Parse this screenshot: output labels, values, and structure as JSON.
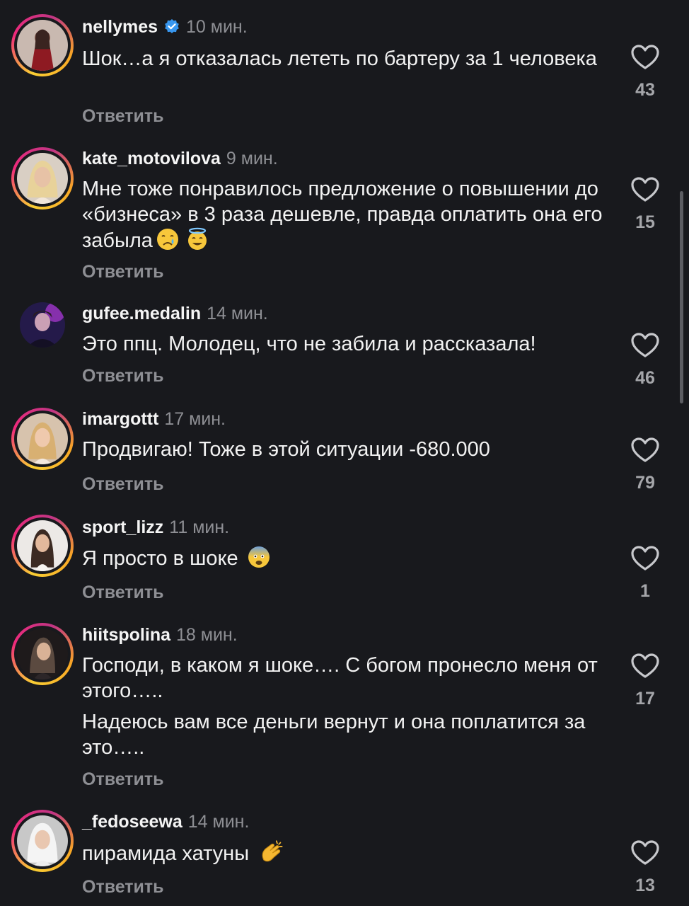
{
  "reply_label": "Ответить",
  "comments": [
    {
      "username": "nellymes",
      "verified": true,
      "time": "10 мин.",
      "text": [
        "Шок…а я отказалась лететь по бартеру за 1 человека"
      ],
      "likes": "43"
    },
    {
      "username": "kate_motovilova",
      "verified": false,
      "time": "9 мин.",
      "text": [
        "Мне тоже понравилось предложение о повышении до «бизнеса» в 3 раза дешевле, правда оплатить она его забыла"
      ],
      "likes": "15"
    },
    {
      "username": "gufee.medalin",
      "verified": false,
      "time": "14 мин.",
      "text": [
        "Это ппц. Молодец, что не забила и рассказала!"
      ],
      "likes": "46"
    },
    {
      "username": "imargottt",
      "verified": false,
      "time": "17 мин.",
      "text": [
        "Продвигаю! Тоже в этой ситуации -680.000"
      ],
      "likes": "79"
    },
    {
      "username": "sport_lizz",
      "verified": false,
      "time": "11 мин.",
      "text": [
        "Я просто в шоке"
      ],
      "likes": "1"
    },
    {
      "username": "hiitspolina",
      "verified": false,
      "time": "18 мин.",
      "text": [
        "Господи, в каком я шоке…. С богом пронесло меня от этого…..",
        "Надеюсь вам все деньги вернут и она поплатится за это….."
      ],
      "likes": "17"
    },
    {
      "username": "_fedoseewa",
      "verified": false,
      "time": "14 мин.",
      "text": [
        "пирамида хатуны"
      ],
      "likes": "13"
    }
  ],
  "colors": {
    "background": "#18191d",
    "secondary_text": "#8e8f94",
    "verified_badge": "#3897f0"
  }
}
